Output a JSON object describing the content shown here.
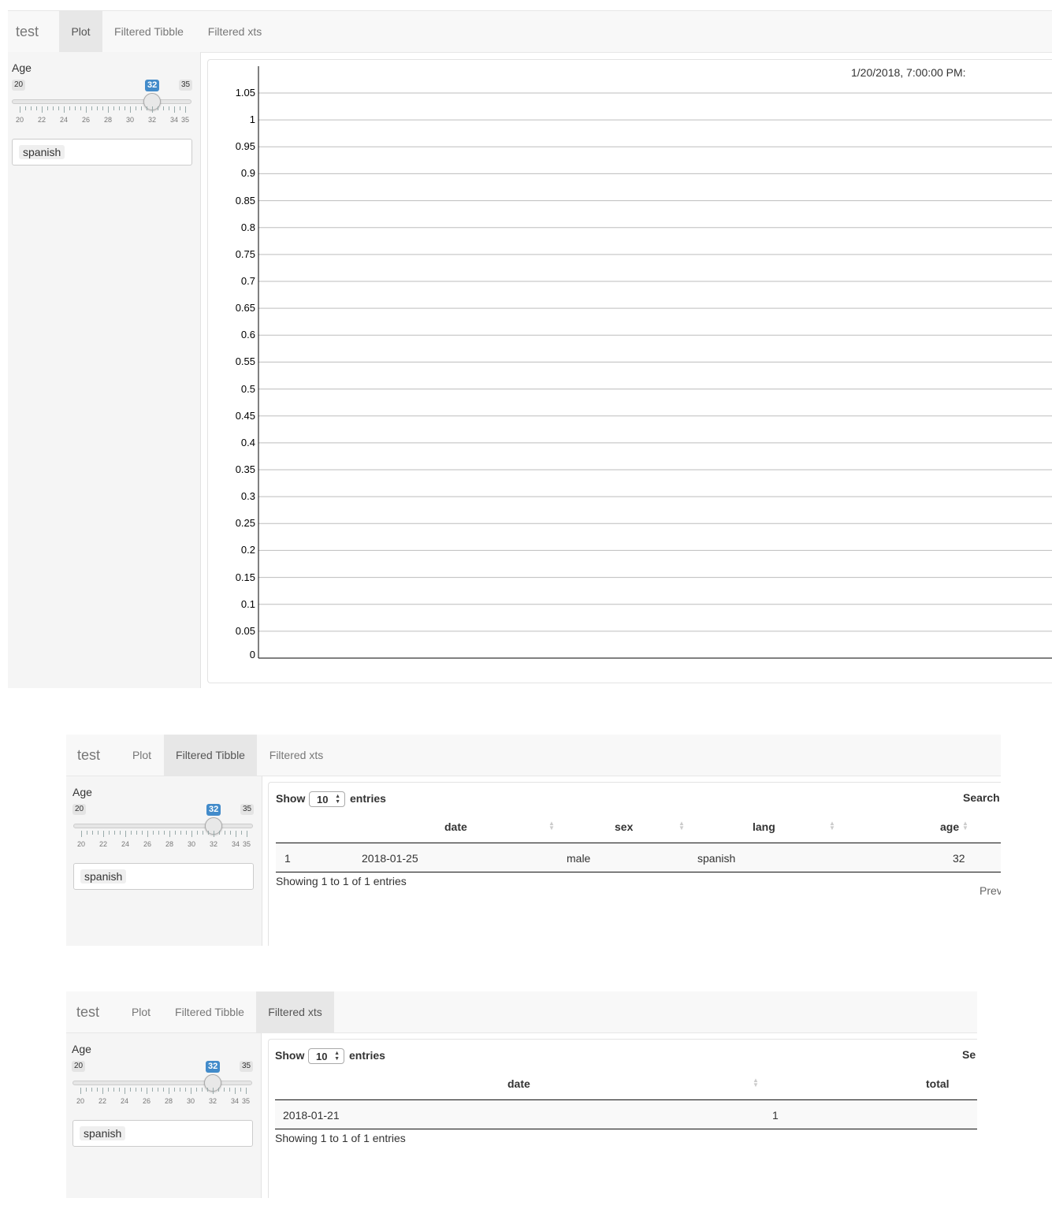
{
  "app": {
    "brand": "test",
    "tabs": [
      "Plot",
      "Filtered Tibble",
      "Filtered xts"
    ]
  },
  "sidebar": {
    "age_label": "Age",
    "slider": {
      "min": 20,
      "max": 35,
      "value": 32,
      "min_label": "20",
      "max_label": "35",
      "value_label": "32",
      "tick_labels": [
        "20",
        "22",
        "24",
        "26",
        "28",
        "30",
        "32",
        "34",
        "35"
      ]
    },
    "language_selected": "spanish"
  },
  "plot": {
    "legend_timestamp": "1/20/2018, 7:00:00 PM:"
  },
  "chart_data": {
    "type": "line",
    "ylim": [
      0,
      1.05
    ],
    "yticks": [
      "1.05",
      "1",
      "0.95",
      "0.9",
      "0.85",
      "0.8",
      "0.75",
      "0.7",
      "0.65",
      "0.6",
      "0.55",
      "0.5",
      "0.45",
      "0.4",
      "0.35",
      "0.3",
      "0.25",
      "0.2",
      "0.15",
      "0.1",
      "0.05",
      "0"
    ],
    "grid": true,
    "series": []
  },
  "tibble": {
    "show_label": "Show",
    "entries_label": "entries",
    "page_length": "10",
    "search_label": "Search",
    "columns": [
      "date",
      "sex",
      "lang",
      "age"
    ],
    "rows": [
      {
        "index": "1",
        "date": "2018-01-25",
        "sex": "male",
        "lang": "spanish",
        "age": "32"
      }
    ],
    "info": "Showing 1 to 1 of 1 entries",
    "prev_label": "Prev"
  },
  "xts": {
    "show_label": "Show",
    "entries_label": "entries",
    "page_length": "10",
    "search_label": "Se",
    "columns": [
      "date",
      "total"
    ],
    "rows": [
      {
        "date": "2018-01-21",
        "total": "1"
      }
    ],
    "info": "Showing 1 to 1 of 1 entries"
  },
  "colors": {
    "accent": "#428bca",
    "navbar_bg": "#f8f8f8",
    "active_tab_bg": "#e7e7e7",
    "sidebar_bg": "#f5f5f5"
  }
}
